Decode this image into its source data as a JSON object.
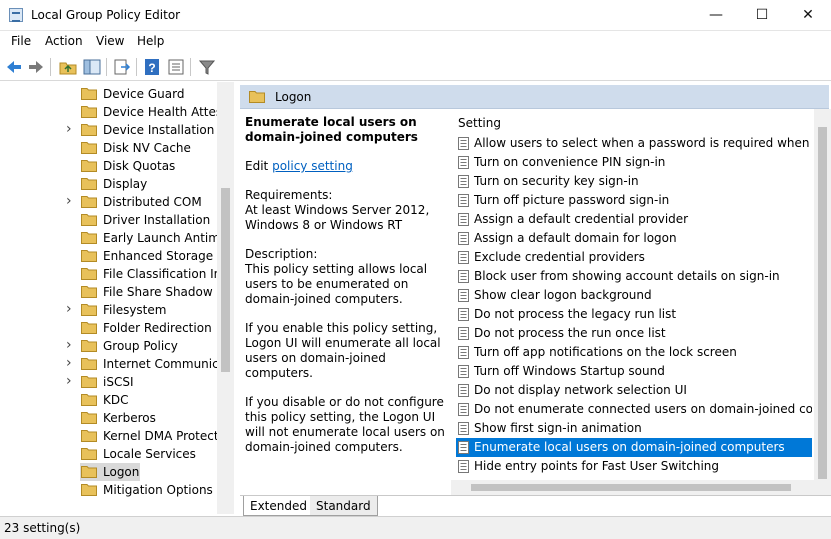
{
  "window": {
    "title": "Local Group Policy Editor"
  },
  "menu": {
    "file": "File",
    "action": "Action",
    "view": "View",
    "help": "Help"
  },
  "toolbar_icons": [
    "back-icon",
    "forward-icon",
    "up-folder-icon",
    "show-hide-tree-icon",
    "export-list-icon",
    "help-icon",
    "properties-icon",
    "filter-icon"
  ],
  "tree": {
    "items": [
      {
        "label": "Device Guard",
        "expandable": false
      },
      {
        "label": "Device Health Attestation Service",
        "expandable": false
      },
      {
        "label": "Device Installation",
        "expandable": true
      },
      {
        "label": "Disk NV Cache",
        "expandable": false
      },
      {
        "label": "Disk Quotas",
        "expandable": false
      },
      {
        "label": "Display",
        "expandable": false
      },
      {
        "label": "Distributed COM",
        "expandable": true
      },
      {
        "label": "Driver Installation",
        "expandable": false
      },
      {
        "label": "Early Launch Antimalware",
        "expandable": false
      },
      {
        "label": "Enhanced Storage Access",
        "expandable": false
      },
      {
        "label": "File Classification Infrastructure",
        "expandable": false
      },
      {
        "label": "File Share Shadow Copy Provider",
        "expandable": false
      },
      {
        "label": "Filesystem",
        "expandable": true
      },
      {
        "label": "Folder Redirection",
        "expandable": false
      },
      {
        "label": "Group Policy",
        "expandable": true
      },
      {
        "label": "Internet Communication Management",
        "expandable": true
      },
      {
        "label": "iSCSI",
        "expandable": true
      },
      {
        "label": "KDC",
        "expandable": false
      },
      {
        "label": "Kerberos",
        "expandable": false
      },
      {
        "label": "Kernel DMA Protection",
        "expandable": false
      },
      {
        "label": "Locale Services",
        "expandable": false
      },
      {
        "label": "Logon",
        "expandable": false,
        "selected": true
      },
      {
        "label": "Mitigation Options",
        "expandable": false
      }
    ]
  },
  "header": {
    "label": "Logon"
  },
  "description": {
    "title": "Enumerate local users on domain-joined computers",
    "edit_prefix": "Edit",
    "edit_link": "policy setting",
    "requirements_label": "Requirements:",
    "requirements_text": "At least Windows Server 2012, Windows 8 or Windows RT",
    "description_label": "Description:",
    "description_text": "This policy setting allows local users to be enumerated on domain-joined computers.",
    "enable_text": "If you enable this policy setting, Logon UI will enumerate all local users on domain-joined computers.",
    "disable_text": "If you disable or do not configure this policy setting, the Logon UI will not enumerate local users on domain-joined computers."
  },
  "list": {
    "column_header": "Setting",
    "rows": [
      "Allow users to select when a password is required when resu...",
      "Turn on convenience PIN sign-in",
      "Turn on security key sign-in",
      "Turn off picture password sign-in",
      "Assign a default credential provider",
      "Assign a default domain for logon",
      "Exclude credential providers",
      "Block user from showing account details on sign-in",
      "Show clear logon background",
      "Do not process the legacy run list",
      "Do not process the run once list",
      "Turn off app notifications on the lock screen",
      "Turn off Windows Startup sound",
      "Do not display network selection UI",
      "Do not enumerate connected users on domain-joined com...",
      "Show first sign-in animation",
      "Enumerate local users on domain-joined computers",
      "Hide entry points for Fast User Switching"
    ],
    "selected_index": 16
  },
  "tabs": {
    "extended": "Extended",
    "standard": "Standard"
  },
  "status": {
    "text": "23 setting(s)"
  },
  "colors": {
    "selection": "#0078d7",
    "header_strip": "#cfdcec",
    "folder": "#e8c15a",
    "link": "#0060c0"
  }
}
